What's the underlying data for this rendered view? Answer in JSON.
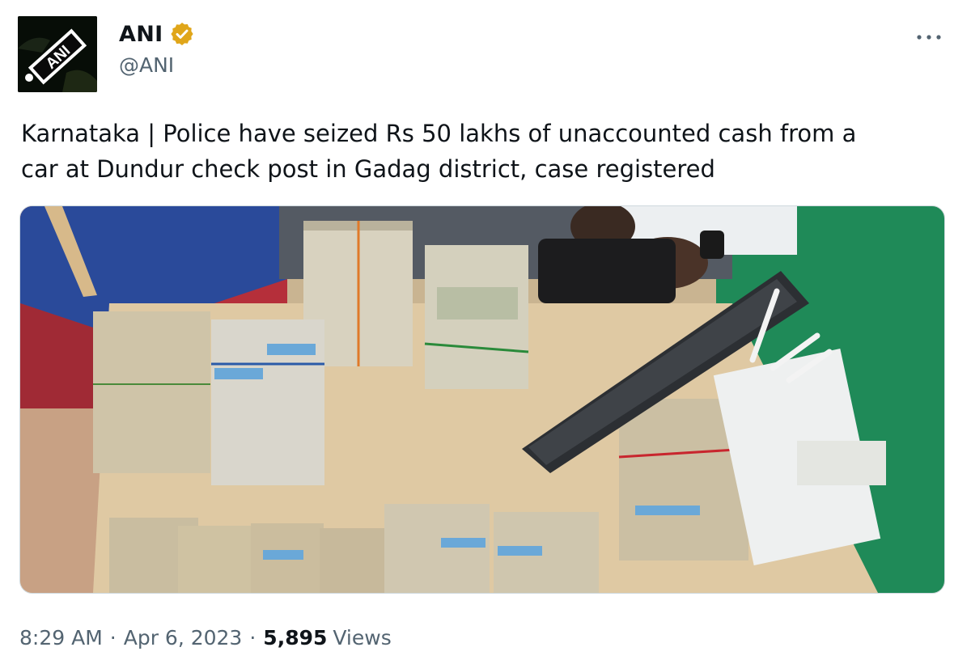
{
  "author": {
    "display_name": "ANI",
    "handle": "@ANI",
    "avatar_text": "ANI",
    "verified_icon": "verified-badge-icon",
    "verified_color": "#e0a61a"
  },
  "more_icon": "more-horizontal-icon",
  "tweet": {
    "text": "Karnataka | Police have seized Rs 50 lakhs of unaccounted cash from a\ncar at Dundur check post in Gadag district, case registered"
  },
  "meta": {
    "time": "8:29 AM",
    "separator": "·",
    "date": "Apr 6, 2023",
    "views_count": "5,895",
    "views_label": "Views"
  },
  "colors": {
    "text_primary": "#0f1419",
    "text_secondary": "#536471",
    "background": "#ffffff"
  }
}
